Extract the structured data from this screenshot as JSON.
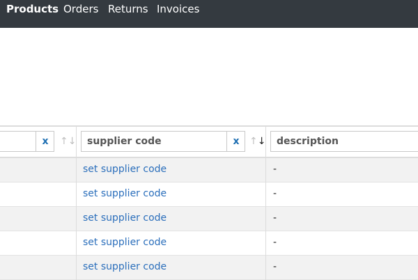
{
  "nav": {
    "items": [
      {
        "label": "Products",
        "active": true
      },
      {
        "label": "Orders",
        "active": false
      },
      {
        "label": "Returns",
        "active": false
      },
      {
        "label": "Invoices",
        "active": false
      }
    ]
  },
  "grid": {
    "columns": [
      {
        "placeholder": "",
        "clear_label": "x",
        "sort_icon": "sort-unsorted-icon"
      },
      {
        "placeholder": "supplier code",
        "clear_label": "x",
        "sort_icon": "sort-descending-icon"
      },
      {
        "placeholder": "description"
      }
    ],
    "sort_glyph_up": "↑",
    "sort_glyph_down": "↓",
    "rows": [
      {
        "supplier_code": "set supplier code",
        "description": "-"
      },
      {
        "supplier_code": "set supplier code",
        "description": "-"
      },
      {
        "supplier_code": "set supplier code",
        "description": "-"
      },
      {
        "supplier_code": "set supplier code",
        "description": "-"
      },
      {
        "supplier_code": "set supplier code",
        "description": "-"
      }
    ]
  },
  "colors": {
    "nav_bg": "#343a40",
    "link": "#2a6ebb",
    "clear_x": "#1f6fb2",
    "row_alt": "#f2f2f2"
  }
}
